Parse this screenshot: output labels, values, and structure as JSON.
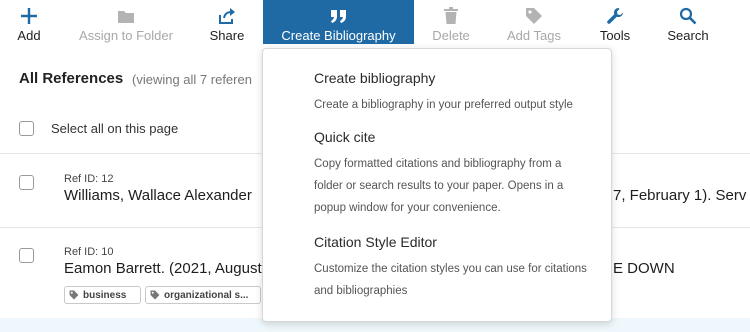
{
  "toolbar": {
    "add": "Add",
    "assign_folder": "Assign to Folder",
    "share": "Share",
    "create_bibliography": "Create Bibliography",
    "delete": "Delete",
    "add_tags": "Add Tags",
    "tools": "Tools",
    "search": "Search"
  },
  "main": {
    "heading": "All References",
    "viewing_text": "(viewing all 7 referen",
    "select_all": "Select all on this page"
  },
  "references": [
    {
      "ref_id": "Ref ID: 12",
      "text_left": "Williams, Wallace Alexander",
      "text_right": "7, February 1). Serv"
    },
    {
      "ref_id": "Ref ID: 10",
      "text_left": "Eamon Barrett. (2021, August",
      "text_right": "E DOWN",
      "tags": [
        "business",
        "organizational s..."
      ]
    }
  ],
  "dropdown": {
    "items": [
      {
        "title": "Create bibliography",
        "desc": [
          "Create a bibliography in your preferred output style"
        ]
      },
      {
        "title": "Quick cite",
        "desc": [
          "Copy formatted citations and bibliography from a",
          "folder or search results to your paper. Opens in a",
          "popup window for your convenience."
        ]
      },
      {
        "title": "Citation Style Editor",
        "desc": [
          "Customize the citation styles you can use for citations",
          "and bibliographies"
        ]
      }
    ]
  },
  "colors": {
    "accent": "#1f6aa5",
    "disabled": "#a8a8a8"
  }
}
